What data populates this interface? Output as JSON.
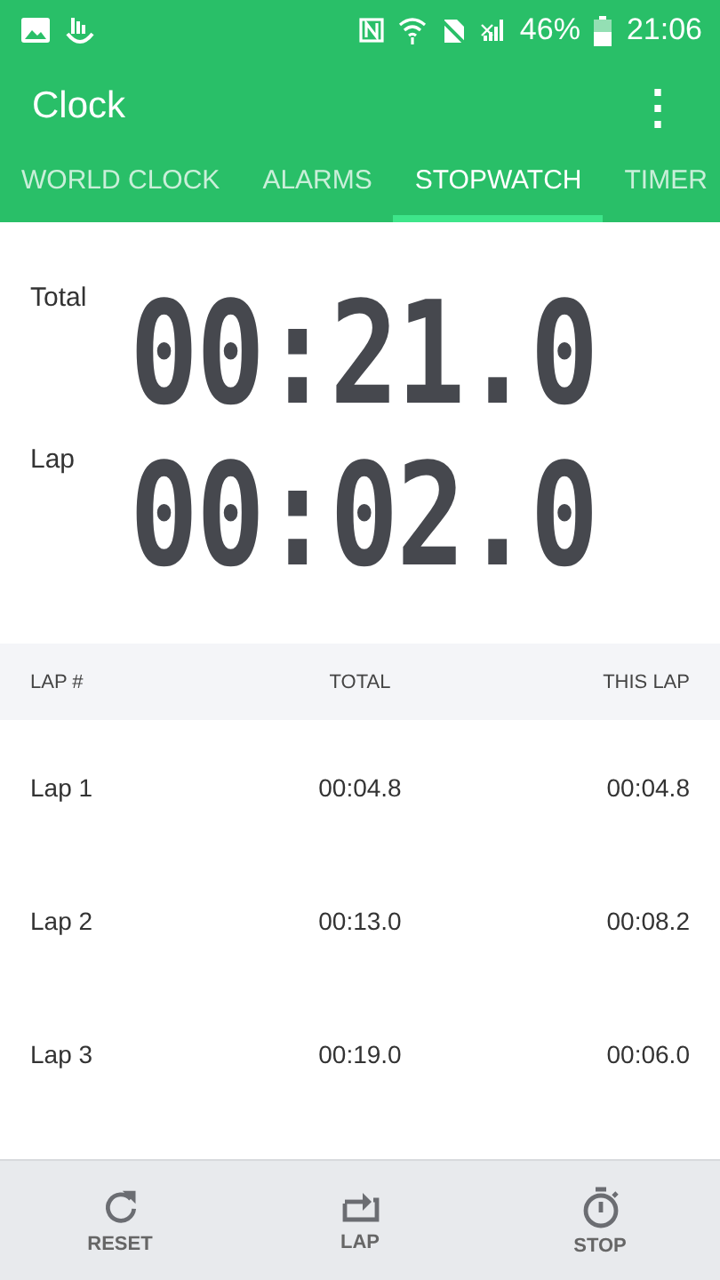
{
  "status_bar": {
    "battery": "46%",
    "time": "21:06"
  },
  "app_bar": {
    "title": "Clock",
    "menu": "⋮"
  },
  "tabs": [
    {
      "label": "WORLD CLOCK",
      "selected": false
    },
    {
      "label": "ALARMS",
      "selected": false
    },
    {
      "label": "STOPWATCH",
      "selected": true
    },
    {
      "label": "TIMER",
      "selected": false
    }
  ],
  "timers": [
    {
      "label": "Total",
      "reading": "00:21.0"
    },
    {
      "label": "Lap",
      "reading": "00:02.0"
    }
  ],
  "laps": {
    "columns": [
      "LAP #",
      "TOTAL",
      "THIS LAP"
    ],
    "rows": [
      [
        "Lap 1",
        "00:04.8",
        "00:04.8"
      ],
      [
        "Lap 2",
        "00:13.0",
        "00:08.2"
      ],
      [
        "Lap 3",
        "00:19.0",
        "00:06.0"
      ]
    ]
  },
  "actions": [
    {
      "kind": "reset",
      "label": "RESET"
    },
    {
      "kind": "lap",
      "label": "LAP"
    },
    {
      "kind": "stop",
      "label": "STOP"
    }
  ]
}
